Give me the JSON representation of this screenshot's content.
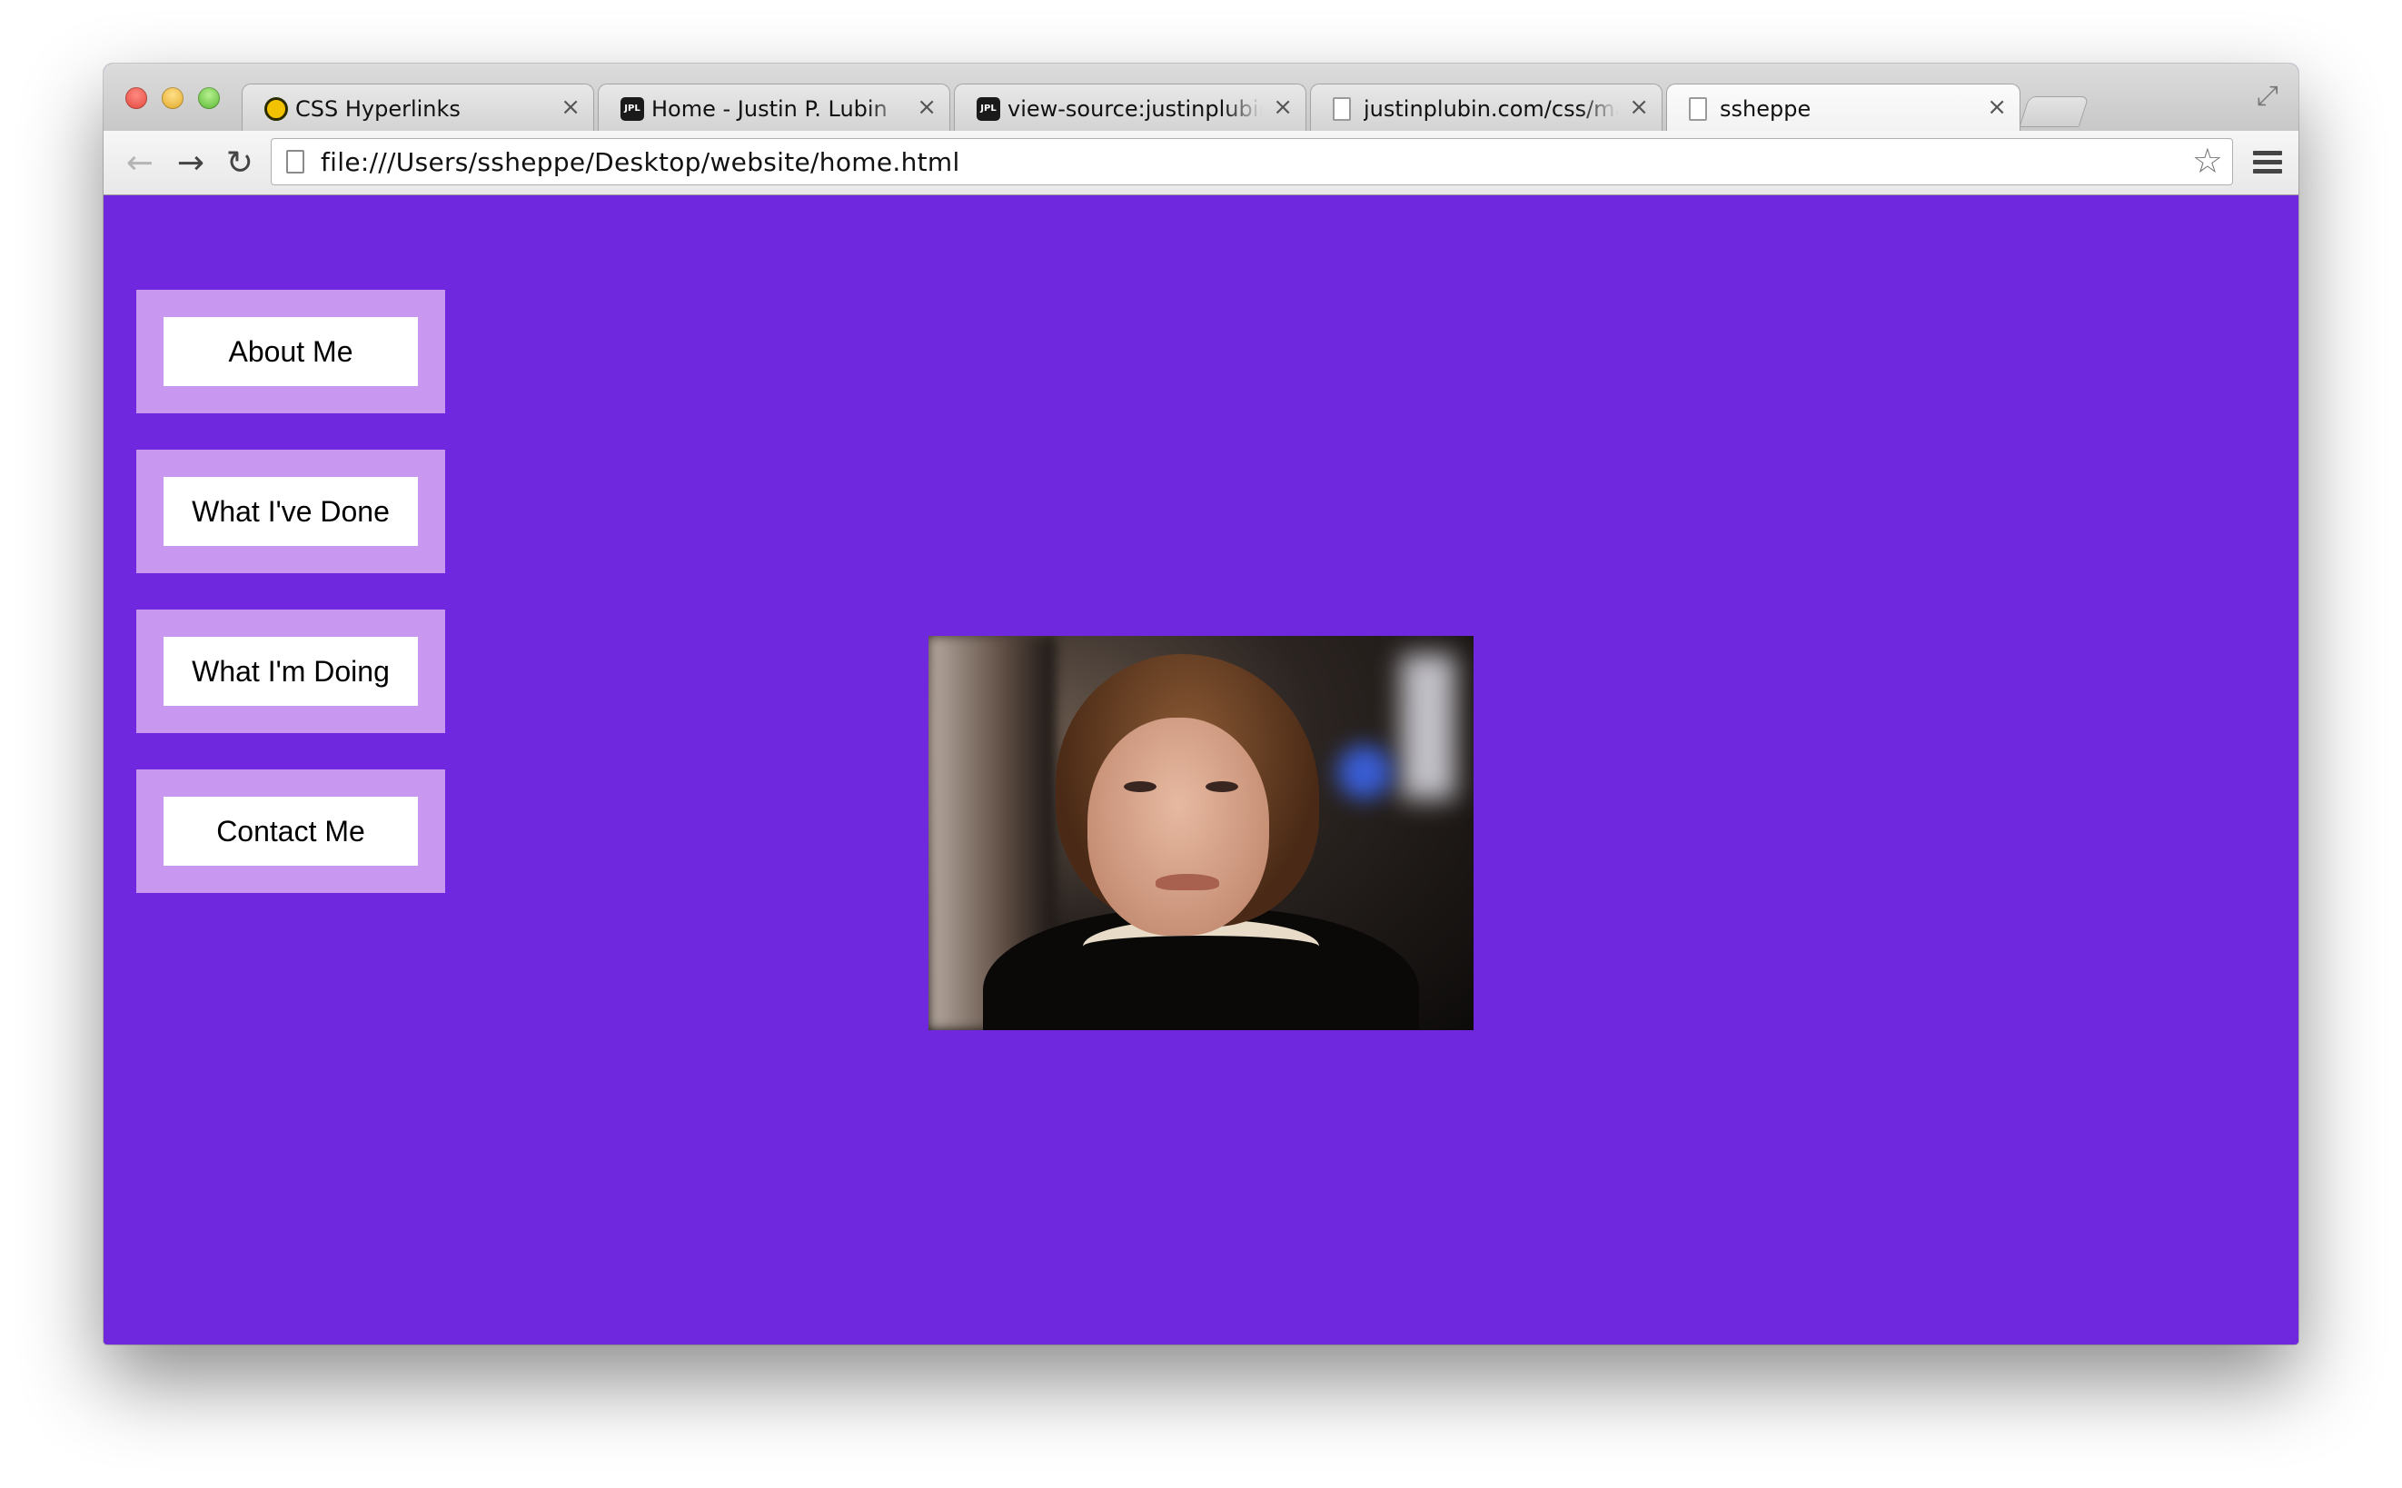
{
  "browser": {
    "tabs": [
      {
        "title": "CSS Hyperlinks",
        "favicon": "q-circle-icon"
      },
      {
        "title": "Home - Justin P. Lubin",
        "favicon": "jpl-icon"
      },
      {
        "title": "view-source:justinplubin.com",
        "favicon": "jpl-icon"
      },
      {
        "title": "justinplubin.com/css/main.css",
        "favicon": "page-icon"
      },
      {
        "title": "ssheppe",
        "favicon": "page-icon",
        "active": true
      }
    ],
    "close_glyph": "×",
    "address_bar": {
      "url": "file:///Users/ssheppe/Desktop/website/home.html"
    },
    "icons": {
      "back": "←",
      "forward": "→",
      "reload": "↻",
      "bookmark_star": "☆",
      "fullscreen": "⤢"
    }
  },
  "page": {
    "background_color": "#6f28de",
    "nav_card_color": "#c897ef",
    "nav": [
      {
        "label": "About Me"
      },
      {
        "label": "What I've Done"
      },
      {
        "label": "What I'm Doing"
      },
      {
        "label": "Contact Me"
      }
    ],
    "image": {
      "subject": "photo-of-woman-eye-roll"
    }
  }
}
